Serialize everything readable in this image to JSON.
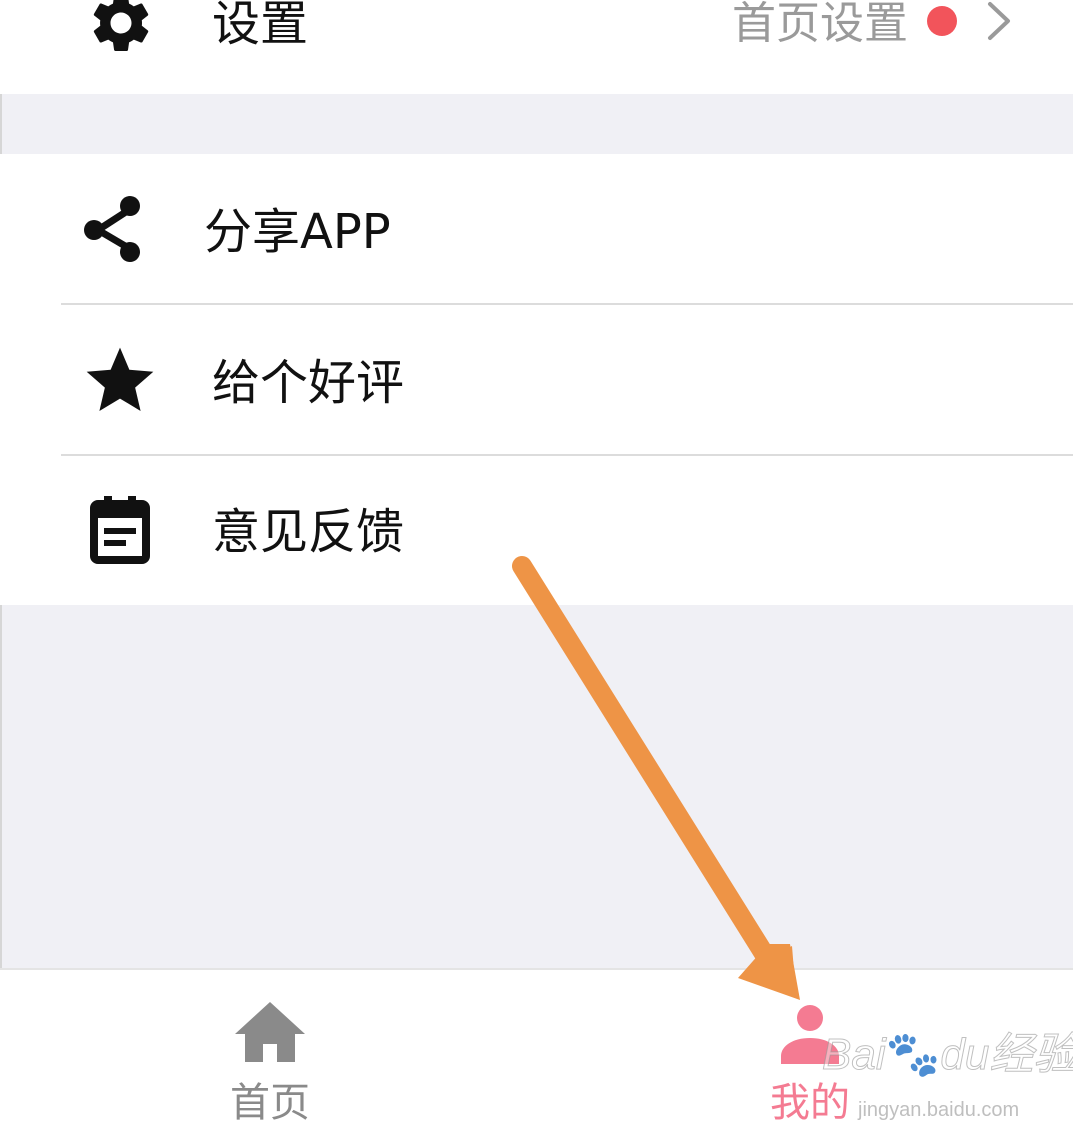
{
  "settings": {
    "label": "设置",
    "value": "首页设置",
    "icon": "gear-icon",
    "badge_color": "#f2545b"
  },
  "menu": [
    {
      "label": "分享APP",
      "icon": "share-icon"
    },
    {
      "label": "给个好评",
      "icon": "star-icon"
    },
    {
      "label": "意见反馈",
      "icon": "feedback-icon"
    }
  ],
  "tabbar": {
    "tabs": [
      {
        "label": "首页",
        "icon": "home-icon",
        "active": false,
        "color": "#8a8a8a"
      },
      {
        "label": "我的",
        "icon": "person-icon",
        "active": true,
        "color": "#f47b92"
      }
    ]
  },
  "annotation": {
    "color": "#ee9446"
  },
  "watermark": {
    "logo": "Baidu经验",
    "url": "jingyan.baidu.com"
  }
}
